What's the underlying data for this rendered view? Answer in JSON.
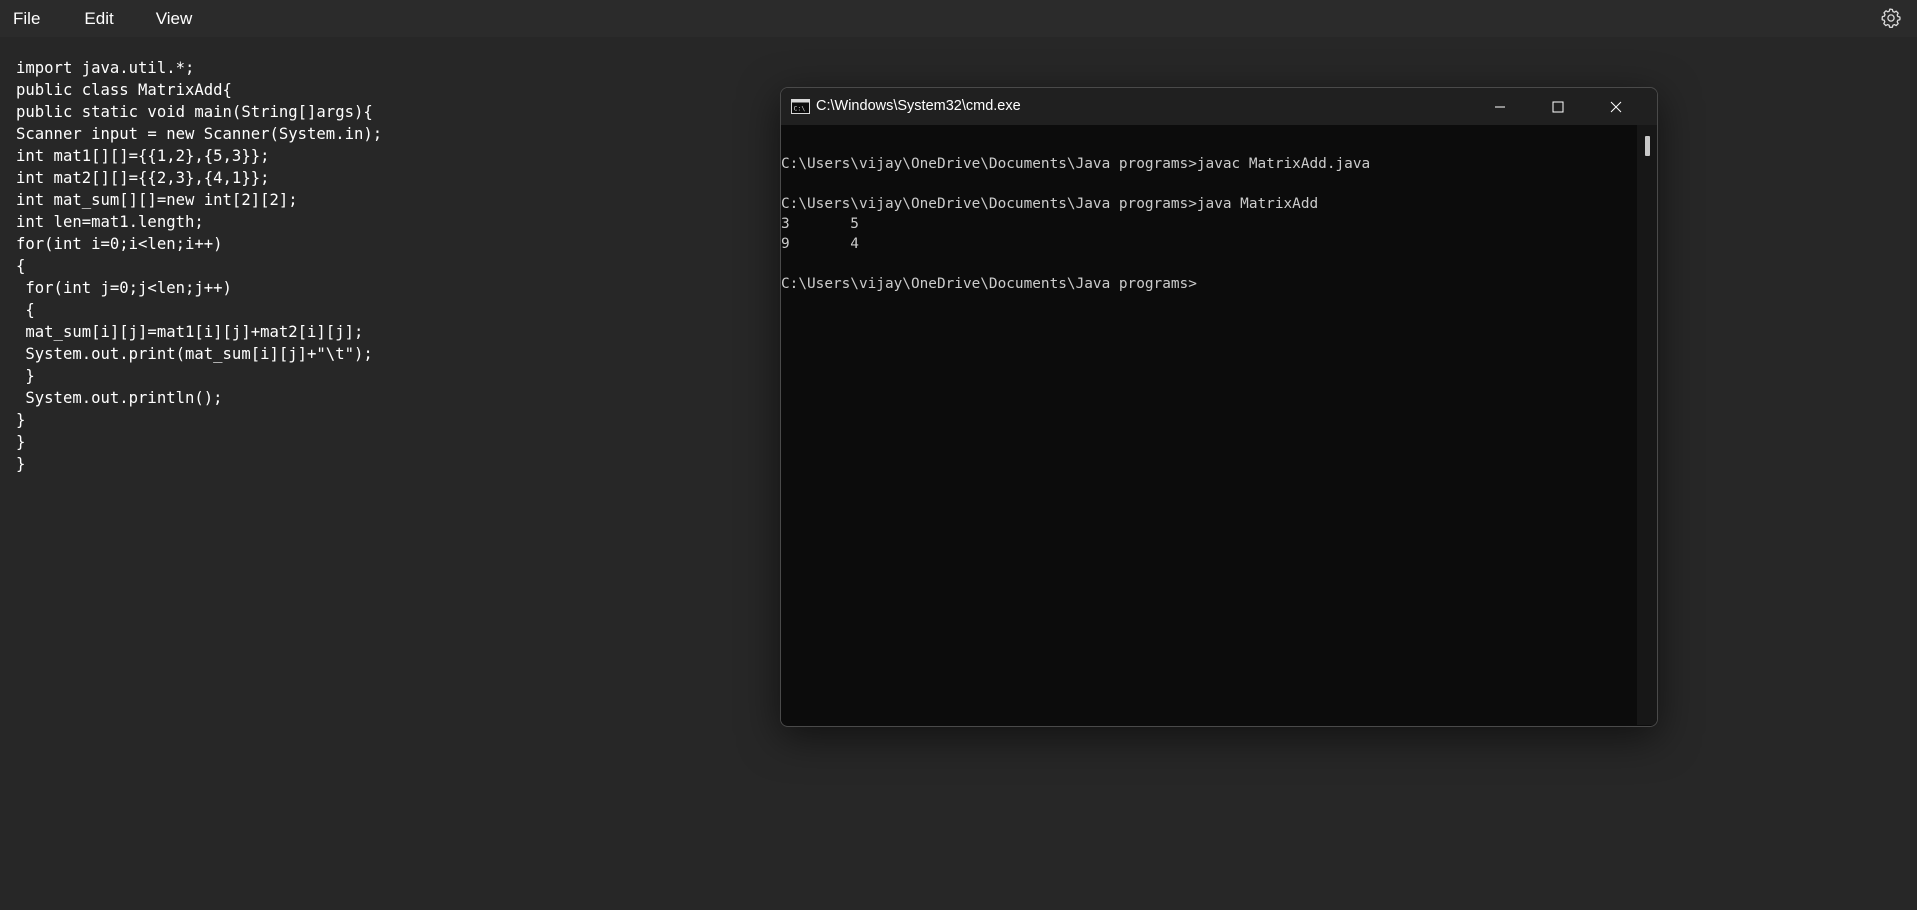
{
  "menubar": {
    "items": [
      "File",
      "Edit",
      "View"
    ],
    "settings_icon": "gear-icon"
  },
  "editor": {
    "lines": [
      "import java.util.*;",
      "public class MatrixAdd{",
      "public static void main(String[]args){",
      "Scanner input = new Scanner(System.in);",
      "int mat1[][]={{1,2},{5,3}};",
      "int mat2[][]={{2,3},{4,1}};",
      "int mat_sum[][]=new int[2][2];",
      "int len=mat1.length;",
      "for(int i=0;i<len;i++)",
      "{",
      " for(int j=0;j<len;j++)",
      " {",
      " mat_sum[i][j]=mat1[i][j]+mat2[i][j];",
      " System.out.print(mat_sum[i][j]+\"\\t\");",
      " }",
      " System.out.println();",
      "}",
      "}",
      "}"
    ]
  },
  "cmd": {
    "title": "C:\\Windows\\System32\\cmd.exe",
    "app_icon": "cmd-icon",
    "buttons": {
      "minimize": "minimize-icon",
      "maximize": "maximize-icon",
      "close": "close-icon"
    },
    "lines": [
      "",
      "C:\\Users\\vijay\\OneDrive\\Documents\\Java programs>javac MatrixAdd.java",
      "",
      "C:\\Users\\vijay\\OneDrive\\Documents\\Java programs>java MatrixAdd",
      "3       5",
      "9       4",
      "",
      "C:\\Users\\vijay\\OneDrive\\Documents\\Java programs>"
    ]
  },
  "colors": {
    "background": "#272727",
    "menubar": "#2b2b2b",
    "console_bg": "#0c0c0c",
    "console_text": "#cccccc",
    "titlebar": "#202020"
  }
}
